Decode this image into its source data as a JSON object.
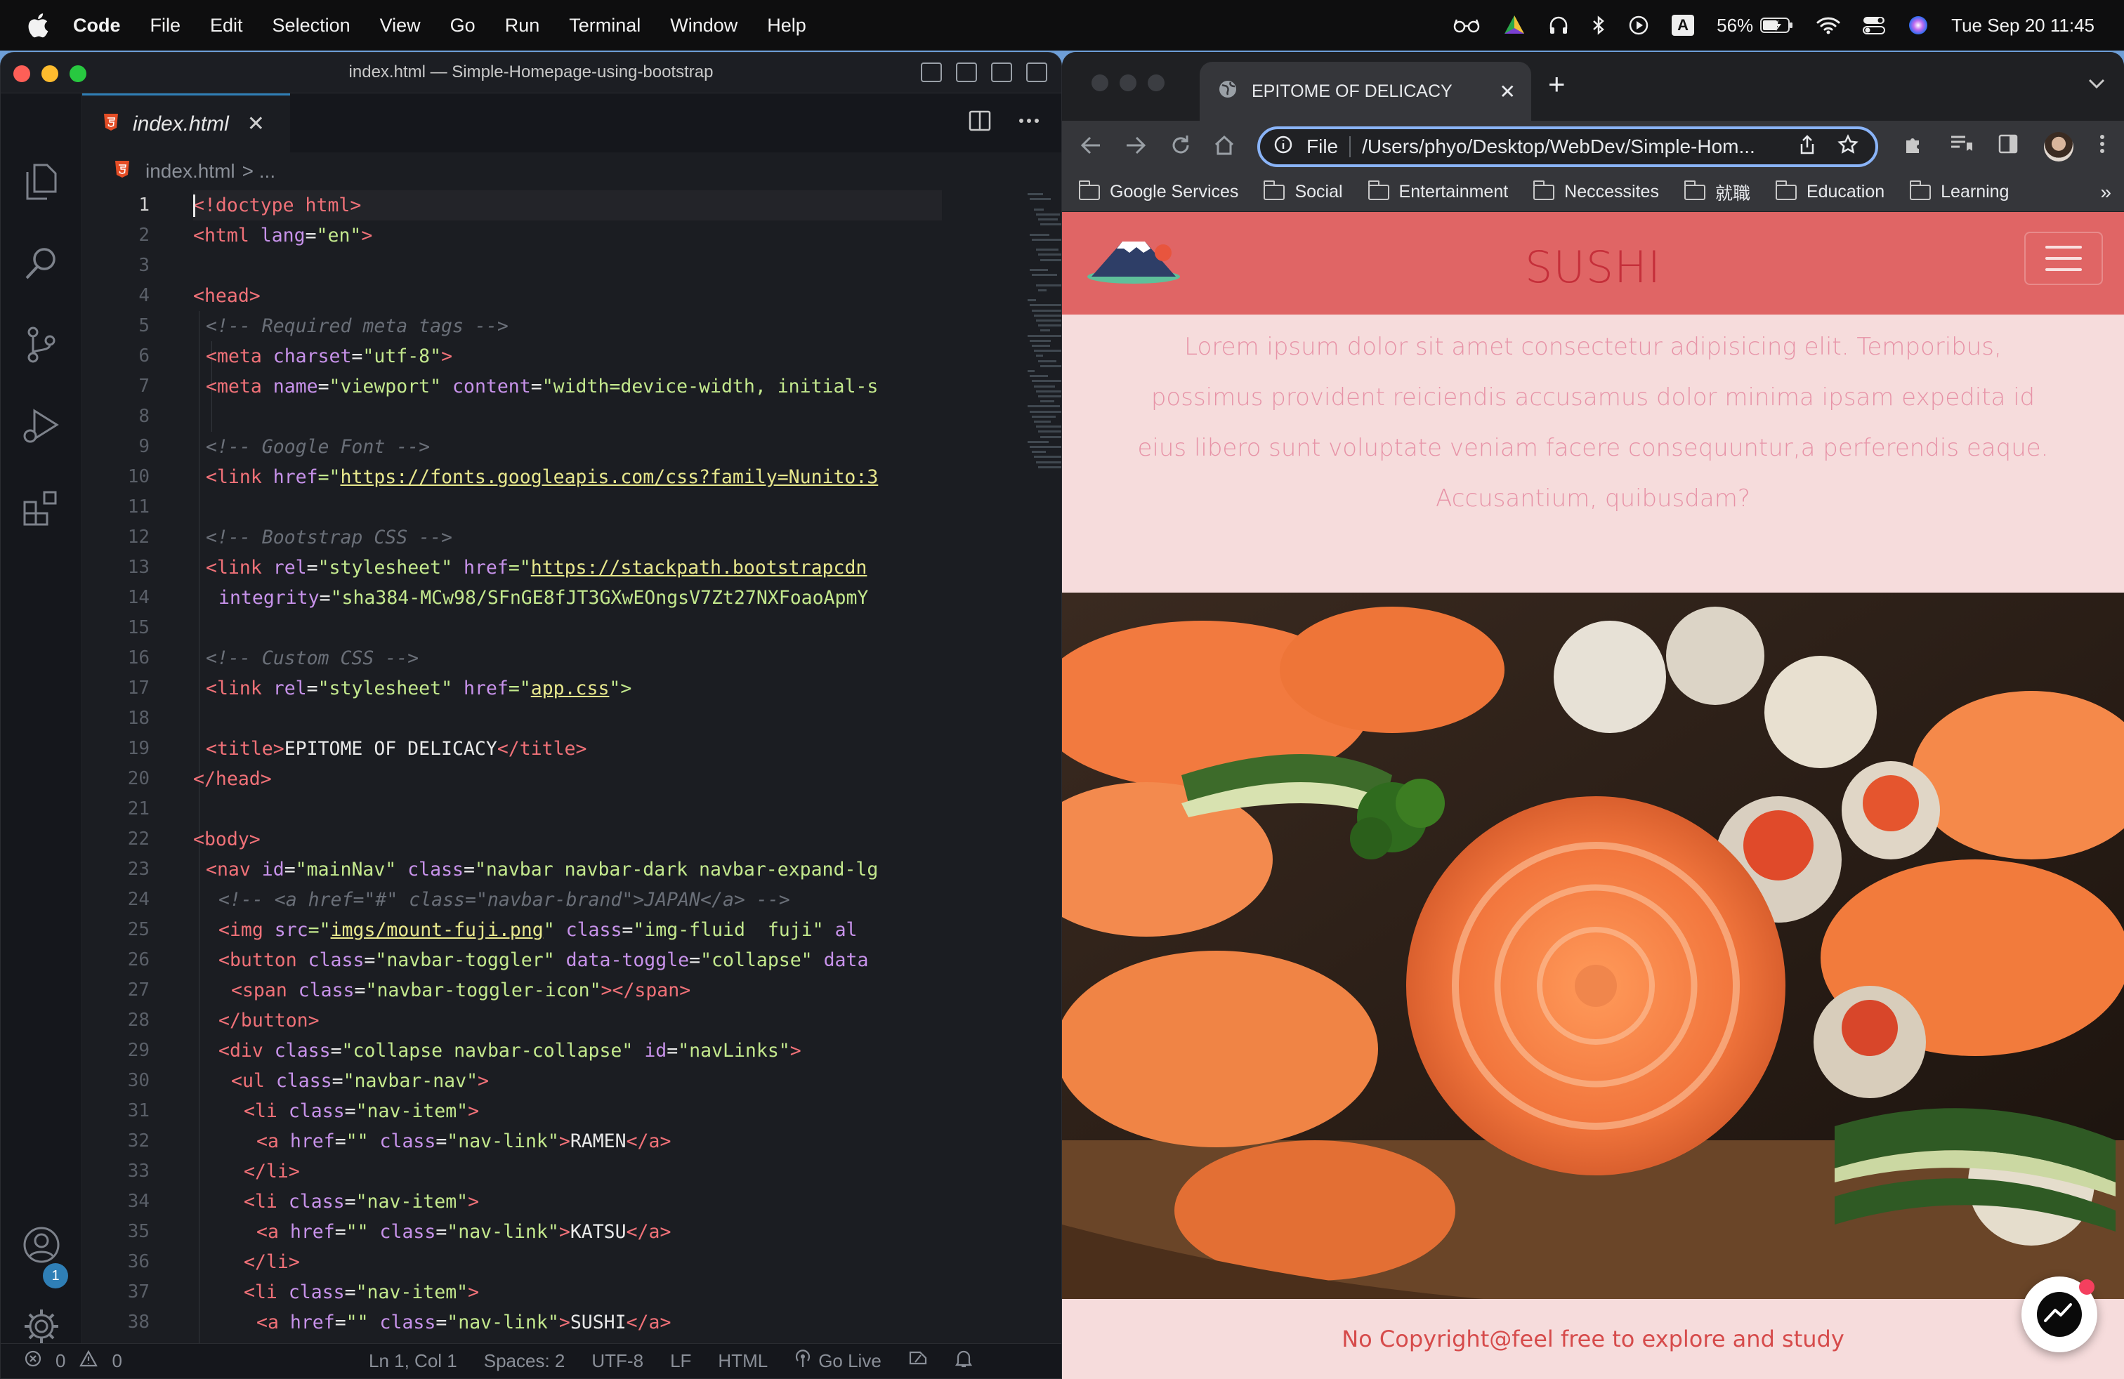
{
  "menubar": {
    "app_name": "Code",
    "items": [
      "File",
      "Edit",
      "Selection",
      "View",
      "Go",
      "Run",
      "Terminal",
      "Window",
      "Help"
    ],
    "battery": "56%",
    "input_source": "A",
    "datetime": "Tue Sep 20  11:45"
  },
  "vscode": {
    "window_title": "index.html — Simple-Homepage-using-bootstrap",
    "tab": {
      "filename": "index.html",
      "close": "✕"
    },
    "breadcrumb": {
      "file": "index.html",
      "rest": "> ..."
    },
    "notification_badge": "1",
    "lines": [
      {
        "n": "1"
      },
      {
        "n": "2"
      },
      {
        "n": "3"
      },
      {
        "n": "4"
      },
      {
        "n": "5"
      },
      {
        "n": "6"
      },
      {
        "n": "7"
      },
      {
        "n": "8"
      },
      {
        "n": "9"
      },
      {
        "n": "10"
      },
      {
        "n": "11"
      },
      {
        "n": "12"
      },
      {
        "n": "13"
      },
      {
        "n": "14"
      },
      {
        "n": "15"
      },
      {
        "n": "16"
      },
      {
        "n": "17"
      },
      {
        "n": "18"
      },
      {
        "n": "19"
      },
      {
        "n": "20"
      },
      {
        "n": "21"
      },
      {
        "n": "22"
      },
      {
        "n": "23"
      },
      {
        "n": "24"
      },
      {
        "n": "25"
      },
      {
        "n": "26"
      },
      {
        "n": "27"
      },
      {
        "n": "28"
      },
      {
        "n": "29"
      },
      {
        "n": "30"
      },
      {
        "n": "31"
      },
      {
        "n": "32"
      },
      {
        "n": "33"
      },
      {
        "n": "34"
      },
      {
        "n": "35"
      },
      {
        "n": "36"
      },
      {
        "n": "37"
      },
      {
        "n": "38"
      }
    ],
    "code": {
      "l1": "<!doctype html>",
      "l2a": "<html ",
      "l2b": "lang",
      "l2c": "=",
      "l2d": "\"en\"",
      "l2e": ">",
      "l4": "<head>",
      "l5": "<!-- Required meta tags -->",
      "l6a": "<meta ",
      "l6b": "charset",
      "l6c": "=",
      "l6d": "\"utf-8\"",
      "l6e": ">",
      "l7a": "<meta ",
      "l7b": "name",
      "l7c": "=",
      "l7d": "\"viewport\"",
      "l7e": " content",
      "l7f": "=",
      "l7g": "\"width=device-width, initial-s",
      "l9": "<!-- Google Font -->",
      "l10a": "<link ",
      "l10b": "href",
      "l10c": "=\"",
      "l10d": "https://fonts.googleapis.com/css?family=Nunito:3",
      "l12": "<!-- Bootstrap CSS -->",
      "l13a": "<link ",
      "l13b": "rel",
      "l13c": "=",
      "l13d": "\"stylesheet\"",
      "l13e": " href",
      "l13f": "=\"",
      "l13g": "https://stackpath.bootstrapcdn",
      "l14a": "integrity",
      "l14b": "=",
      "l14c": "\"sha384-MCw98/SFnGE8fJT3GXwEOngsV7Zt27NXFoaoApmY",
      "l16": "<!-- Custom CSS -->",
      "l17a": "<link ",
      "l17b": "rel",
      "l17c": "=",
      "l17d": "\"stylesheet\"",
      "l17e": " href",
      "l17f": "=\"",
      "l17g": "app.css",
      "l17h": "\">",
      "l19a": "<title>",
      "l19b": "EPITOME OF DELICACY",
      "l19c": "</title>",
      "l20": "</head>",
      "l22": "<body>",
      "l23a": "<nav ",
      "l23b": "id",
      "l23c": "=",
      "l23d": "\"mainNav\"",
      "l23e": " class",
      "l23f": "=",
      "l23g": "\"navbar navbar-dark navbar-expand-lg",
      "l24": "<!-- <a href=\"#\" class=\"navbar-brand\">JAPAN</a> -->",
      "l25a": "<img ",
      "l25b": "src",
      "l25c": "=\"",
      "l25d": "imgs/mount-fuji.png",
      "l25e": "\"",
      "l25f": " class",
      "l25g": "=",
      "l25h": "\"img-fluid  fuji\"",
      "l25i": " al",
      "l26a": "<button ",
      "l26b": "class",
      "l26c": "=",
      "l26d": "\"navbar-toggler\"",
      "l26e": " data-toggle",
      "l26f": "=",
      "l26g": "\"collapse\"",
      "l26h": " data",
      "l27a": "<span ",
      "l27b": "class",
      "l27c": "=",
      "l27d": "\"navbar-toggler-icon\"",
      "l27e": "></span>",
      "l28": "</button>",
      "l29a": "<div ",
      "l29b": "class",
      "l29c": "=",
      "l29d": "\"collapse navbar-collapse\"",
      "l29e": " id",
      "l29f": "=",
      "l29g": "\"navLinks\"",
      "l29h": ">",
      "l30a": "<ul ",
      "l30b": "class",
      "l30c": "=",
      "l30d": "\"navbar-nav\"",
      "l30e": ">",
      "l31a": "<li ",
      "l31b": "class",
      "l31c": "=",
      "l31d": "\"nav-item\"",
      "l31e": ">",
      "l32a": "<a ",
      "l32b": "href",
      "l32c": "=",
      "l32d": "\"\"",
      "l32e": " class",
      "l32f": "=",
      "l32g": "\"nav-link\"",
      "l32h": ">",
      "l32i": "RAMEN",
      "l32j": "</a>",
      "l33": "</li>",
      "l34a": "<li ",
      "l34b": "class",
      "l34c": "=",
      "l34d": "\"nav-item\"",
      "l34e": ">",
      "l35a": "<a ",
      "l35b": "href",
      "l35c": "=",
      "l35d": "\"\"",
      "l35e": " class",
      "l35f": "=",
      "l35g": "\"nav-link\"",
      "l35h": ">",
      "l35i": "KATSU",
      "l35j": "</a>",
      "l36": "</li>",
      "l37a": "<li ",
      "l37b": "class",
      "l37c": "=",
      "l37d": "\"nav-item\"",
      "l37e": ">",
      "l38a": "<a ",
      "l38b": "href",
      "l38c": "=",
      "l38d": "\"\"",
      "l38e": " class",
      "l38f": "=",
      "l38g": "\"nav-link\"",
      "l38h": ">",
      "l38i": "SUSHI",
      "l38j": "</a>"
    },
    "status": {
      "errors": "0",
      "warnings": "0",
      "position": "Ln 1, Col 1",
      "spaces": "Spaces: 2",
      "encoding": "UTF-8",
      "eol": "LF",
      "language": "HTML",
      "live": "Go Live"
    }
  },
  "chrome": {
    "tab_title": "EPITOME OF DELICACY",
    "tab_close": "✕",
    "new_tab": "+",
    "scheme_label": "File",
    "url": "/Users/phyo/Desktop/WebDev/Simple-Hom...",
    "bookmarks": [
      "Google Services",
      "Social",
      "Entertainment",
      "Neccessites",
      "就職",
      "Education",
      "Learning"
    ],
    "bookmarks_more": "»"
  },
  "site": {
    "brand": "SUSHI",
    "lead": "Lorem ipsum dolor sit amet consectetur adipisicing elit. Temporibus, possimus provident reiciendis accusamus dolor minima ipsam expedita id eius libero sunt voluptate veniam facere consequuntur,a perferendis eaque. Accusantium, quibusdam?",
    "footer": "No Copyright@feel free to explore and study"
  },
  "colors": {
    "accent": "#2f7fb6",
    "navbar": "#e06565",
    "page_bg": "#f6dcdc",
    "brand_text": "#c52f3a",
    "omnibox_focus": "#8ab4f8"
  }
}
